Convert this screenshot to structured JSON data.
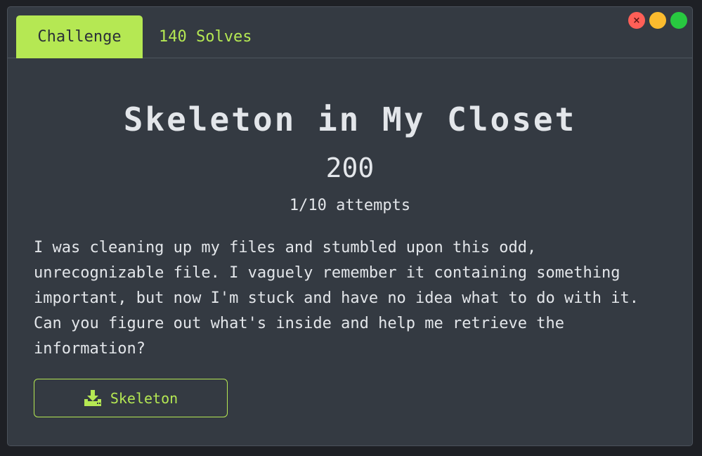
{
  "tabs": {
    "challenge_label": "Challenge",
    "solves_label": "140 Solves"
  },
  "window_controls": {
    "close_glyph": "×",
    "close_color": "#ff5f57",
    "minimize_color": "#fbbb2e",
    "maximize_color": "#28c840"
  },
  "challenge": {
    "title": "Skeleton in My Closet",
    "points": "200",
    "attempts": "1/10 attempts",
    "description": "I was cleaning up my files and stumbled upon this odd, unrecognizable file. I vaguely remember it containing something important, but now I'm stuck and have no idea what to do with it. Can you figure out what's inside and help me retrieve the information?"
  },
  "download": {
    "label": "Skeleton",
    "icon": "download-icon"
  },
  "colors": {
    "accent": "#b5e853",
    "panel_bg": "#343a42",
    "text": "#e3e6ea",
    "page_bg": "#1e2025"
  }
}
